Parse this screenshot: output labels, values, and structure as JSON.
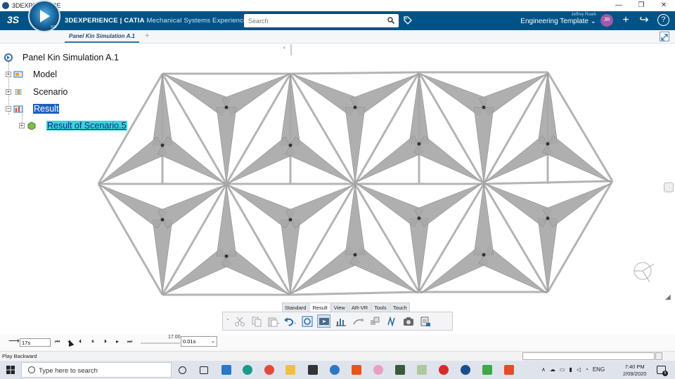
{
  "window": {
    "title": "3DEXPERIENCE",
    "min": "—",
    "max": "❐",
    "close": "✕"
  },
  "header": {
    "ds_logo": "3S",
    "compass_v": "V.R",
    "brand_main": "3DEXPERIENCE | CATIA",
    "brand_sub": " Mechanical Systems Experience",
    "search_placeholder": "Search",
    "user_name": "Jeffrey Roark",
    "template": "Engineering Template ⌄",
    "avatar": "JR",
    "add": "+",
    "share": "↪",
    "help": "?"
  },
  "tabs": {
    "active": "Panel Kin Simulation A.1",
    "add": "+"
  },
  "tree": {
    "root": "Panel Kin Simulation A.1",
    "items": [
      "Model",
      "Scenario",
      "Result",
      "Result of Scenario.5"
    ]
  },
  "action_bar": {
    "tabs": [
      "Standard",
      "Result",
      "View",
      "AR-VR",
      "Tools",
      "Touch"
    ],
    "active_tab": "Result"
  },
  "timeline": {
    "current": "17s",
    "max_time": "17.00",
    "step": "0.01s",
    "buttons": [
      "⏮",
      "◂",
      "⏴",
      "⏸",
      "⏵",
      "▸",
      "⏭"
    ]
  },
  "status": {
    "text": "Play Backward"
  },
  "taskbar": {
    "search_text": "Type here to search",
    "lang": "ENG",
    "time": "7:40 PM",
    "date": "2/09/2020",
    "notif_count": "5"
  },
  "colors": {
    "header": "#005386",
    "panel_gray": "#a8a8a8",
    "select_blue": "#1f5fbf",
    "select_cyan": "#3fd3d6"
  }
}
